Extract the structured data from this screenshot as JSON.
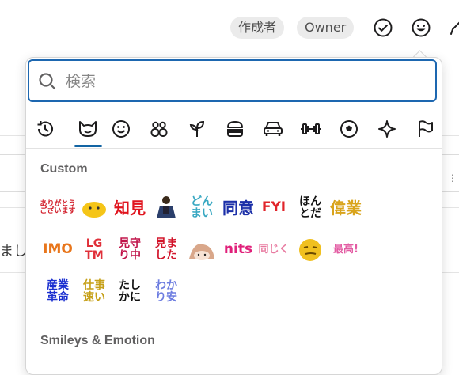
{
  "header": {
    "author_badge": "作成者",
    "owner_badge": "Owner"
  },
  "background": {
    "partial_text": "まし"
  },
  "picker": {
    "search_placeholder": "検索",
    "categories": [
      {
        "id": "recent",
        "icon": "history-icon"
      },
      {
        "id": "custom",
        "icon": "cat-face-icon"
      },
      {
        "id": "smileys",
        "icon": "smiley-icon"
      },
      {
        "id": "people",
        "icon": "people-icon"
      },
      {
        "id": "nature",
        "icon": "sprout-icon"
      },
      {
        "id": "food",
        "icon": "burger-icon"
      },
      {
        "id": "travel",
        "icon": "car-icon"
      },
      {
        "id": "activities",
        "icon": "dumbbell-icon"
      },
      {
        "id": "objects",
        "icon": "soccer-ball-icon"
      },
      {
        "id": "symbols",
        "icon": "sparkle-icon"
      },
      {
        "id": "flags",
        "icon": "flag-icon"
      }
    ],
    "section_custom": "Custom",
    "section_smileys": "Smileys & Emotion",
    "custom_emoji": [
      {
        "text": "ありがとう\nございます",
        "color": "#d21f2b"
      },
      {
        "text": "",
        "kind": "blob",
        "color": "#f5c518"
      },
      {
        "text": "知見",
        "color": "#e0141e"
      },
      {
        "text": "",
        "kind": "person",
        "color": "#2b3f6b"
      },
      {
        "text": "どん\nまい",
        "color": "#39a8c2"
      },
      {
        "text": "同意",
        "color": "#1b2fa8"
      },
      {
        "text": "FYI",
        "color": "#e0242a"
      },
      {
        "text": "ほん\nとだ",
        "color": "#111111"
      },
      {
        "text": "偉業",
        "color": "#d9a41c"
      },
      {
        "text": "IMO",
        "color": "#e8761c"
      },
      {
        "text": "LG\nTM",
        "color": "#e0303a"
      },
      {
        "text": "見守\nり中",
        "color": "#c0144a"
      },
      {
        "text": "見ま\nした",
        "color": "#d2142a"
      },
      {
        "text": "",
        "kind": "anime",
        "color": "#d9a78a"
      },
      {
        "text": "nits",
        "color": "#e0207a"
      },
      {
        "text": "同じく",
        "color": "#e87aa0"
      },
      {
        "text": "",
        "kind": "smirk",
        "color": "#f0c020"
      },
      {
        "text": "最高!",
        "color": "#e35ca3"
      },
      {
        "text": "産業\n革命",
        "color": "#1a2fd0"
      },
      {
        "text": "仕事\n速い",
        "color": "#c6a018"
      },
      {
        "text": "たし\nかに",
        "color": "#111111"
      },
      {
        "text": "わか\nり安",
        "color": "#6d7de0"
      }
    ]
  },
  "colors": {
    "accent": "#1264a3",
    "search_border": "#1d67b0",
    "badge_bg": "#ebebeb",
    "section_title": "#616061"
  }
}
